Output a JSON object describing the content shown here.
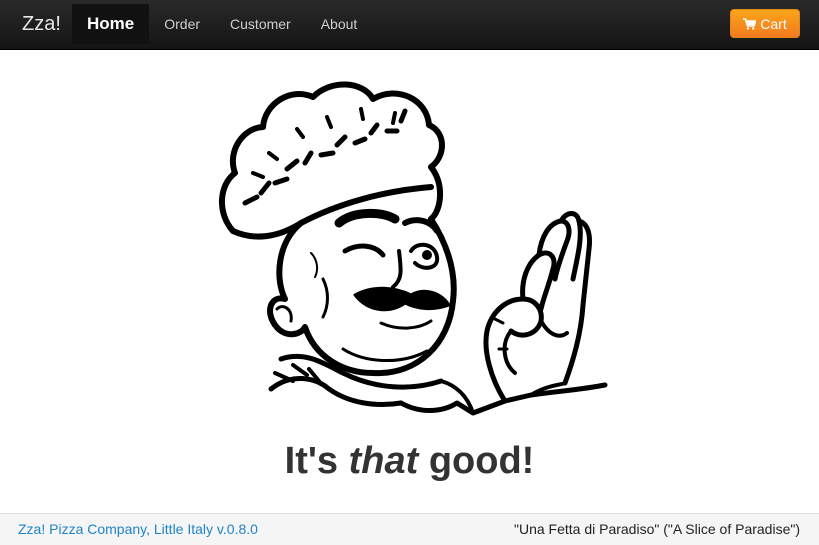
{
  "navbar": {
    "brand": "Zza!",
    "items": [
      {
        "label": "Home",
        "active": true
      },
      {
        "label": "Order",
        "active": false
      },
      {
        "label": "Customer",
        "active": false
      },
      {
        "label": "About",
        "active": false
      }
    ],
    "cart_label": "Cart",
    "cart_icon": "cart-icon",
    "cart_color": "#f89406"
  },
  "hero": {
    "image": "chef-okay-gesture-illustration",
    "tagline_before": "It's",
    "tagline_emphasis": "that",
    "tagline_after": "good!"
  },
  "footer": {
    "left_text": "Zza! Pizza Company, Little Italy v.0.8.0",
    "right_text": "\"Una Fetta di Paradiso\" (\"A Slice of Paradise\")",
    "link_color": "#1f84c8"
  }
}
